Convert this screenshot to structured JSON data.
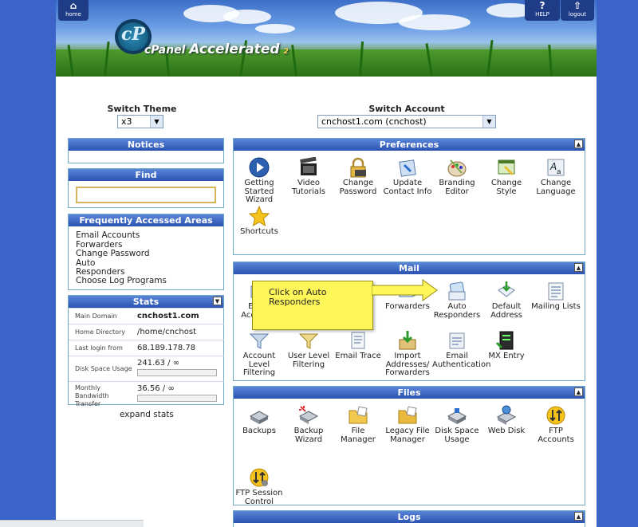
{
  "header": {
    "home_label": "home",
    "help_label": "HELP",
    "logout_label": "logout",
    "logo_cp": "cP",
    "logo_name": "cPanel",
    "logo_accelerated": "Accelerated",
    "logo_version": "2"
  },
  "switch_theme": {
    "label": "Switch Theme",
    "value": "x3"
  },
  "switch_account": {
    "label": "Switch Account",
    "value": "cnchost1.com (cnchost)"
  },
  "notices": {
    "title": "Notices"
  },
  "find": {
    "title": "Find",
    "value": ""
  },
  "faa": {
    "title": "Frequently Accessed Areas",
    "items": [
      "Email Accounts",
      "Forwarders",
      "Change Password",
      "Auto",
      "Responders",
      "Choose Log Programs"
    ]
  },
  "stats": {
    "title": "Stats",
    "rows": [
      {
        "label": "Main Domain",
        "value": "cnchost1.com"
      },
      {
        "label": "Home Directory",
        "value": "/home/cnchost"
      },
      {
        "label": "Last login from",
        "value": "68.189.178.78"
      },
      {
        "label": "Disk Space Usage",
        "value": "241.63 / ∞",
        "fill": 0
      },
      {
        "label": "Monthly Bandwidth Transfer",
        "value": "36.56 / ∞",
        "fill": 0
      }
    ],
    "expand_label": "expand stats"
  },
  "preferences": {
    "title": "Preferences",
    "items": [
      {
        "label": "Getting Started Wizard",
        "icon": "play-icon"
      },
      {
        "label": "Video Tutorials",
        "icon": "film-icon"
      },
      {
        "label": "Change Password",
        "icon": "padlock-icon"
      },
      {
        "label": "Update Contact Info",
        "icon": "contact-card-icon"
      },
      {
        "label": "Branding Editor",
        "icon": "paint-palette-icon"
      },
      {
        "label": "Change Style",
        "icon": "style-window-icon"
      },
      {
        "label": "Change Language",
        "icon": "language-icon"
      },
      {
        "label": "Shortcuts",
        "icon": "star-icon"
      }
    ]
  },
  "mail": {
    "title": "Mail",
    "items": [
      {
        "label": "Email Accounts",
        "icon": "email-accounts-icon"
      },
      {
        "label": "Forwarders",
        "icon": "forwarders-icon"
      },
      {
        "label": "Auto Responders",
        "icon": "auto-responder-icon"
      },
      {
        "label": "Default Address",
        "icon": "default-address-icon"
      },
      {
        "label": "Mailing Lists",
        "icon": "mailing-list-icon"
      },
      {
        "label": "Account Level Filtering",
        "icon": "filter-icon"
      },
      {
        "label": "User Level Filtering",
        "icon": "user-filter-icon"
      },
      {
        "label": "Email Trace",
        "icon": "trace-icon"
      },
      {
        "label": "Import Addresses/ Forwarders",
        "icon": "import-icon"
      },
      {
        "label": "Email Authentication",
        "icon": "authentication-icon"
      },
      {
        "label": "MX Entry",
        "icon": "mx-server-icon"
      }
    ],
    "callout": "Click on Auto Responders"
  },
  "files": {
    "title": "Files",
    "items": [
      {
        "label": "Backups",
        "icon": "backup-drive-icon"
      },
      {
        "label": "Backup Wizard",
        "icon": "backup-wizard-icon"
      },
      {
        "label": "File Manager",
        "icon": "folder-icon"
      },
      {
        "label": "Legacy File Manager",
        "icon": "legacy-folder-icon"
      },
      {
        "label": "Disk Space Usage",
        "icon": "disk-icon"
      },
      {
        "label": "Web Disk",
        "icon": "web-disk-icon"
      },
      {
        "label": "FTP Accounts",
        "icon": "ftp-accounts-icon"
      },
      {
        "label": "FTP Session Control",
        "icon": "ftp-session-icon"
      }
    ]
  },
  "logs": {
    "title": "Logs"
  }
}
